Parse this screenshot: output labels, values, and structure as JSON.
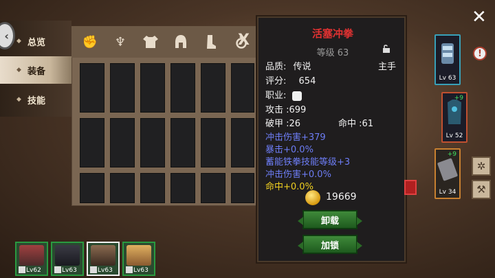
{
  "tabs": [
    {
      "label": "总览"
    },
    {
      "label": "装备"
    },
    {
      "label": "技能"
    }
  ],
  "inventory": {
    "filter_icons": [
      "fist-icon",
      "cloak-icon",
      "shirt-icon",
      "helmet-icon",
      "boot-icon",
      "ring-icon"
    ],
    "close_label": "X"
  },
  "tooltip": {
    "name": "活塞冲拳",
    "level": "等级 63",
    "quality_label": "品质:",
    "quality_value": "传说",
    "slot_value": "主手",
    "score_label": "评分:",
    "score_value": "654",
    "class_label": "职业:",
    "attack": "攻击 :699",
    "armor_pen": "破甲 :26",
    "hit": "命中 :61",
    "bonus": [
      "冲击伤害+379",
      "暴击+0.0%",
      "蓄能铁拳技能等级+3",
      "冲击伤害+0.0%"
    ],
    "bonus_yellow": "命中+0.0%",
    "price": "19669",
    "unequip_label": "卸载",
    "lock_label": "加锁"
  },
  "equipped": [
    {
      "level": "Lv 63",
      "plus": ""
    },
    {
      "level": "Lv 52",
      "plus": "+9"
    },
    {
      "level": "Lv 34",
      "plus": "+9"
    }
  ],
  "party": [
    {
      "level": "Lv62"
    },
    {
      "level": "Lv63"
    },
    {
      "level": "Lv63"
    },
    {
      "level": "Lv63"
    }
  ],
  "colors": {
    "title_red": "#e23232",
    "bonus_blue": "#6d7df5",
    "bonus_yellow": "#f0d020",
    "button_green": "#2a6a26"
  }
}
